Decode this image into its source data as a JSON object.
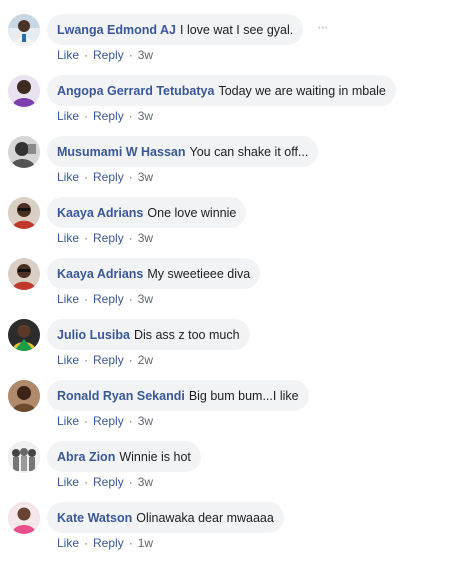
{
  "actions": {
    "like": "Like",
    "reply": "Reply"
  },
  "comments": [
    {
      "name": "Lwanga Edmond AJ",
      "text": "I love wat I see gyal.",
      "time": "3w",
      "avatar": "person-white-shirt"
    },
    {
      "name": "Angopa Gerrard Tetubatya",
      "text": "Today we are waiting in mbale",
      "time": "3w",
      "avatar": "person-purple"
    },
    {
      "name": "Musumami W Hassan",
      "text": "You can shake it off...",
      "time": "3w",
      "avatar": "person-grayscale"
    },
    {
      "name": "Kaaya Adrians",
      "text": "One love winnie",
      "time": "3w",
      "avatar": "person-sunglasses"
    },
    {
      "name": "Kaaya Adrians",
      "text": "My sweetieee diva",
      "time": "3w",
      "avatar": "person-sunglasses"
    },
    {
      "name": "Julio Lusiba",
      "text": "Dis ass z too much",
      "time": "2w",
      "avatar": "person-yellow"
    },
    {
      "name": "Ronald Ryan Sekandi",
      "text": "Big bum bum...I like",
      "time": "3w",
      "avatar": "person-brown"
    },
    {
      "name": "Abra Zion",
      "text": "Winnie is hot",
      "time": "3w",
      "avatar": "group-photo"
    },
    {
      "name": "Kate Watson",
      "text": "Olinawaka dear mwaaaa",
      "time": "1w",
      "avatar": "person-pink"
    }
  ],
  "more_icon": "more-options-icon"
}
